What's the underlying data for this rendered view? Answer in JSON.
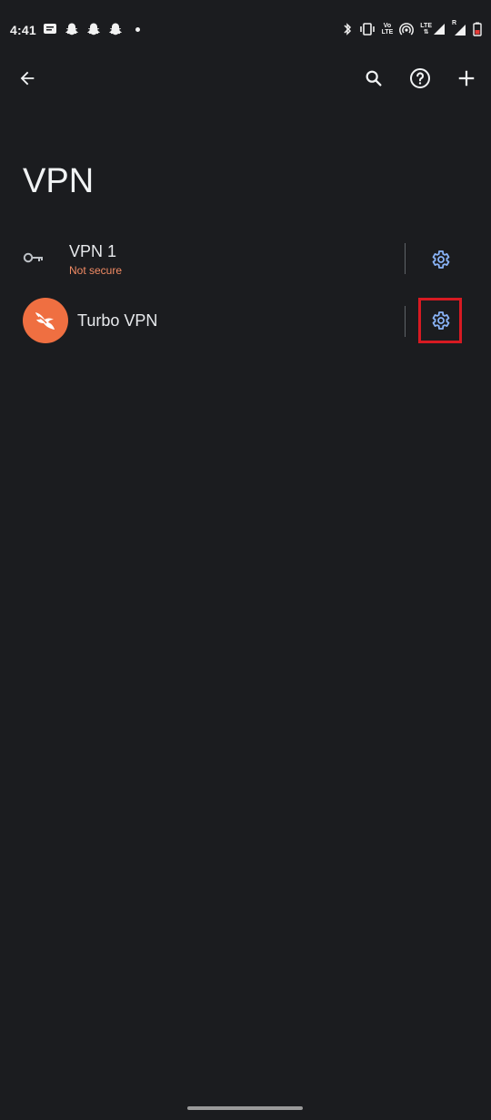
{
  "status_bar": {
    "time": "4:41",
    "left_icons": [
      "message-icon",
      "snapchat-icon",
      "snapchat-icon",
      "snapchat-icon",
      "dot-icon"
    ],
    "right_icons": [
      "bluetooth-icon",
      "vibrate-icon",
      "volte-icon",
      "hotspot-icon",
      "lte-signal-icon",
      "roaming-signal-icon",
      "battery-icon"
    ],
    "volte_label_top": "Vo",
    "volte_label_bottom": "LTE",
    "lte_label": "LTE",
    "roaming_label": "R"
  },
  "app_bar": {
    "back_icon": "arrow-back-icon",
    "actions": [
      "search-icon",
      "help-icon",
      "add-icon"
    ]
  },
  "page": {
    "title": "VPN"
  },
  "vpn_list": [
    {
      "name": "VPN 1",
      "subtitle": "Not secure",
      "icon": "key-icon",
      "settings_icon": "gear-icon"
    },
    {
      "name": "Turbo VPN",
      "subtitle": "",
      "icon": "turbo-vpn-logo",
      "settings_icon": "gear-icon",
      "highlighted": true
    }
  ],
  "colors": {
    "background": "#1b1c1f",
    "accent": "#8ab4f8",
    "warning_text": "#f28b64",
    "highlight_border": "#d71a22",
    "turbo_brand": "#ef6f41"
  }
}
